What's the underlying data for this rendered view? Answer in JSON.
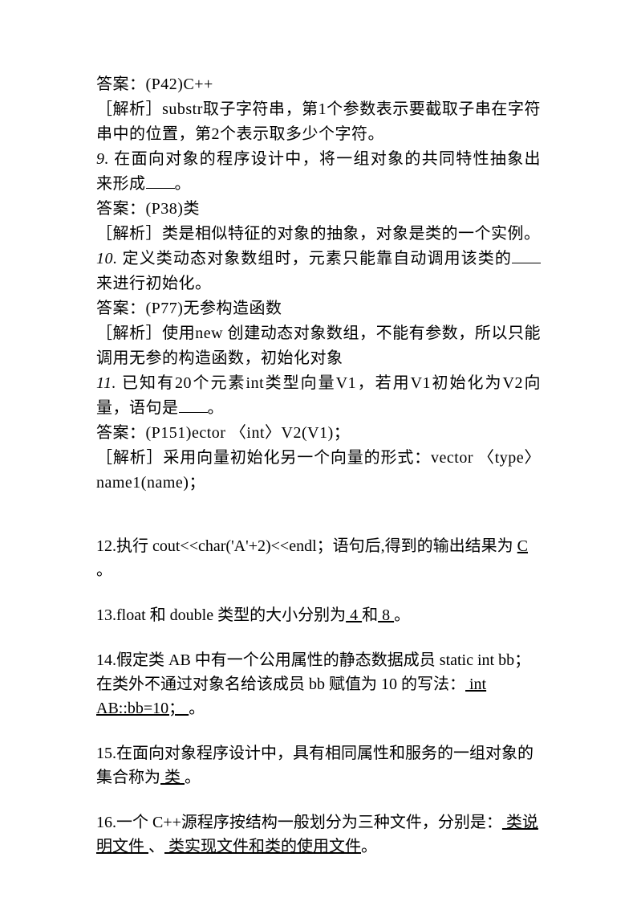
{
  "block1": {
    "l1": "答案：(P42)C++",
    "l2": "［解析］substr取子字符串，第1个参数表示要截取子串在字符串中的位置，第2个表示取多少个字符。",
    "l3a": "9.",
    "l3b": " 在面向对象的程序设计中，将一组对象的共同特性抽象出来形成",
    "l3c": "。",
    "l4": "答案：(P38)类",
    "l5": "［解析］类是相似特征的对象的抽象，对象是类的一个实例。",
    "l6a": "10.",
    "l6b": " 定义类动态对象数组时，元素只能靠自动调用该类的",
    "l6c": "来进行初始化。",
    "l7": "答案：(P77)无参构造函数",
    "l8": "［解析］使用new 创建动态对象数组，不能有参数，所以只能调用无参的构造函数，初始化对象",
    "l9a": "11.",
    "l9b": " 已知有20个元素int类型向量V1，若用V1初始化为V2向量，语句是",
    "l9c": "。",
    "l10": "答案：(P151)ector 〈int〉V2(V1)；",
    "l11": "［解析］采用向量初始化另一个向量的形式：vector 〈type〉 name1(name)；"
  },
  "block2": {
    "q12a": "12.执行 cout<<char('A'+2)<<endl；语句后,得到的输出结果为",
    "q12u": " C  ",
    "q12b": "。",
    "q13a": "13.float 和 double 类型的大小分别为",
    "q13u1": "  4  ",
    "q13m": "和",
    "q13u2": "  8  ",
    "q13b": "。",
    "q14a": "14.假定类 AB 中有一个公用属性的静态数据成员 static int bb；在类外不通过对象名给该成员 bb 赋值为 10 的写法：",
    "q14u": "  int AB::bb=10；  ",
    "q14b": "。",
    "q15a": "15.在面向对象程序设计中，具有相同属性和服务的一组对象的集合称为",
    "q15u": "  类  ",
    "q15b": "。",
    "q16a": "16.一个 C++源程序按结构一般划分为三种文件，分别是：",
    "q16u1": " 类说明文件 ",
    "q16m": "、",
    "q16u2": " 类实现文件和类的使用文件",
    "q16b": "。"
  }
}
